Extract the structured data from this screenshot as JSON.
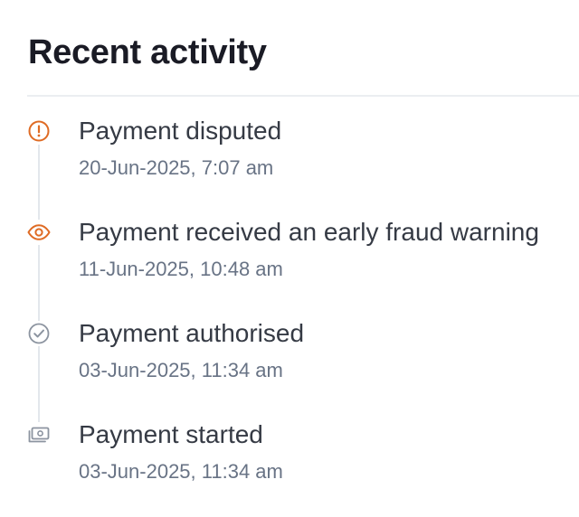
{
  "section": {
    "title": "Recent activity"
  },
  "colors": {
    "warning_orange": "#df6b24",
    "neutral_icon": "#8c94a0",
    "title_text": "#353a44",
    "time_text": "#687385"
  },
  "activity": [
    {
      "icon": "alert-circle-icon",
      "title": "Payment disputed",
      "time": "20-Jun-2025, 7:07 am"
    },
    {
      "icon": "eye-icon",
      "title": "Payment received an early fraud warning",
      "time": "11-Jun-2025, 10:48 am"
    },
    {
      "icon": "check-circle-icon",
      "title": "Payment authorised",
      "time": "03-Jun-2025, 11:34 am"
    },
    {
      "icon": "cash-icon",
      "title": "Payment started",
      "time": "03-Jun-2025, 11:34 am"
    }
  ]
}
